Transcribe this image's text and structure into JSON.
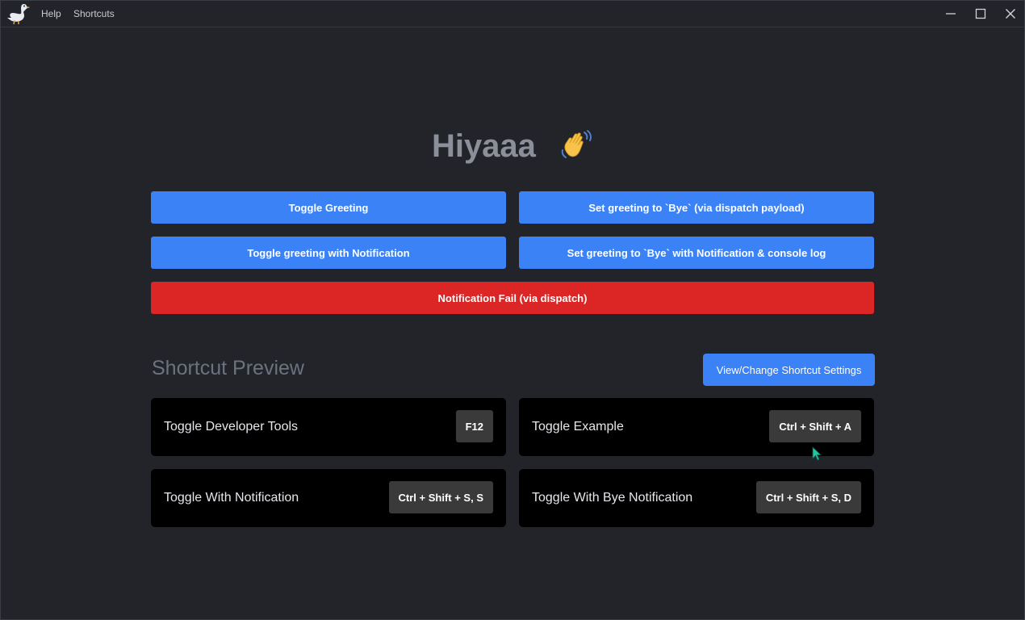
{
  "menu": {
    "help": "Help",
    "shortcuts": "Shortcuts"
  },
  "greeting": {
    "text": "Hiyaaa",
    "emoji_icon": "waving-hand-icon"
  },
  "buttons": {
    "toggle_greeting": "Toggle Greeting",
    "set_bye_payload": "Set greeting to `Bye` (via dispatch payload)",
    "toggle_notification": "Toggle greeting with Notification",
    "set_bye_notification": "Set greeting to `Bye` with Notification & console log",
    "notification_fail": "Notification Fail (via dispatch)"
  },
  "shortcut_section": {
    "title": "Shortcut Preview",
    "settings_button": "View/Change Shortcut Settings",
    "items": [
      {
        "label": "Toggle Developer Tools",
        "keys": "F12"
      },
      {
        "label": "Toggle Example",
        "keys": "Ctrl + Shift + A"
      },
      {
        "label": "Toggle With Notification",
        "keys": "Ctrl + Shift + S, S"
      },
      {
        "label": "Toggle With Bye Notification",
        "keys": "Ctrl + Shift + S, D"
      }
    ]
  },
  "colors": {
    "accent_blue": "#3b82f6",
    "danger_red": "#dc2626",
    "background": "#222429"
  }
}
